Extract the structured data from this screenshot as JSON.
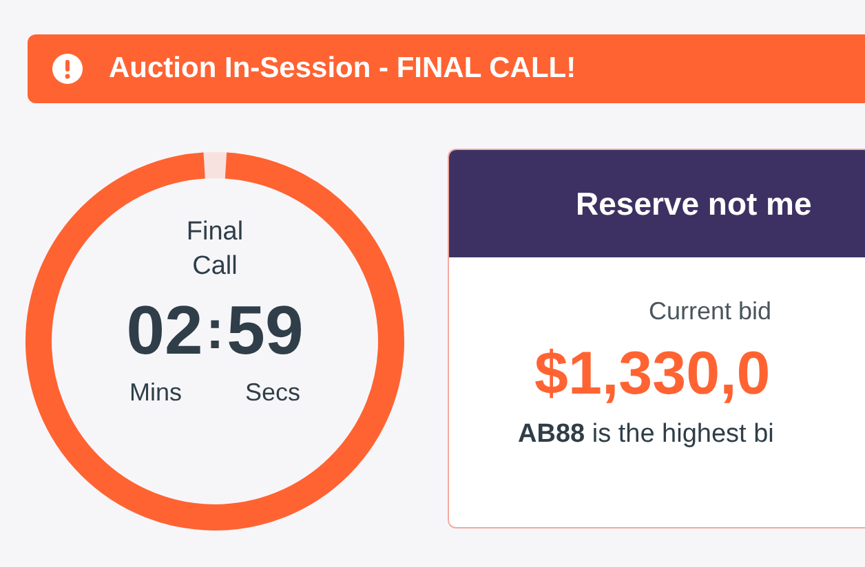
{
  "alert": {
    "text": "Auction In-Session - FINAL CALL!"
  },
  "timer": {
    "label": "Final Call",
    "minutes": "02",
    "separator": ":",
    "seconds": "59",
    "minutes_label": "Mins",
    "seconds_label": "Secs",
    "level": 0.98
  },
  "bid_card": {
    "status": "Reserve not me",
    "caption": "Current bid",
    "amount": "$1,330,0",
    "bidder_note": "**AB88** is the highest bi"
  }
}
